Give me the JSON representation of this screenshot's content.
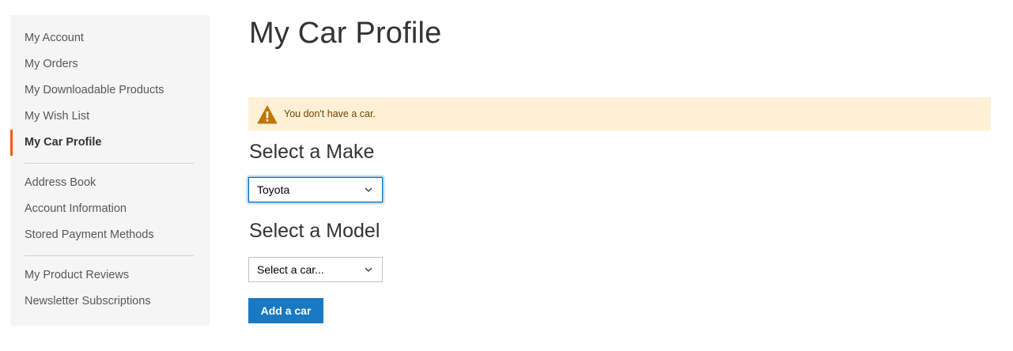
{
  "sidebar": {
    "items": [
      {
        "label": "My Account"
      },
      {
        "label": "My Orders"
      },
      {
        "label": "My Downloadable Products"
      },
      {
        "label": "My Wish List"
      },
      {
        "label": "My Car Profile"
      },
      {
        "label": "Address Book"
      },
      {
        "label": "Account Information"
      },
      {
        "label": "Stored Payment Methods"
      },
      {
        "label": "My Product Reviews"
      },
      {
        "label": "Newsletter Subscriptions"
      }
    ],
    "active_item": "My Car Profile",
    "active_color": "#ff5501"
  },
  "main": {
    "title": "My Car Profile",
    "warning": {
      "icon": "warning-icon",
      "text": "You don't have a car.",
      "background": "#fdf0d5",
      "icon_color": "#c07600"
    },
    "make_section": {
      "title": "Select a Make",
      "selected": "Toyota"
    },
    "model_section": {
      "title": "Select a Model",
      "selected": "Select a car..."
    },
    "add_button": {
      "label": "Add a car",
      "color": "#1979c3"
    }
  }
}
